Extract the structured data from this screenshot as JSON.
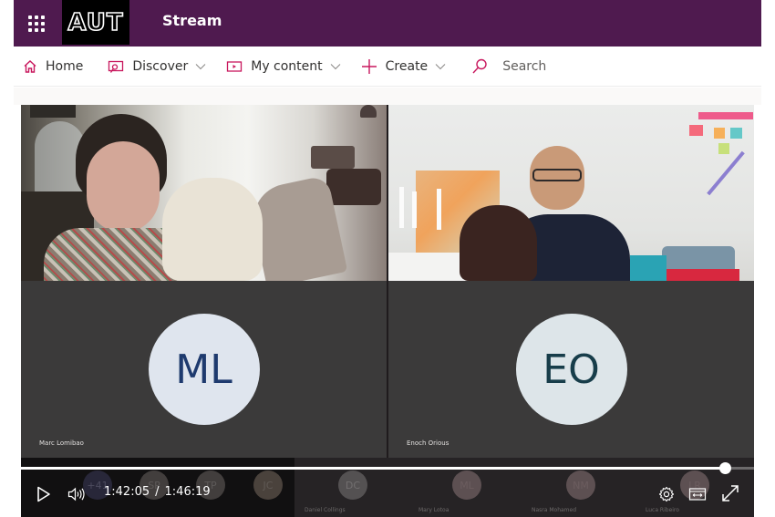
{
  "header": {
    "app_launcher_icon": "waffle-grid-icon",
    "brand_logo_text": "AUT",
    "app_name": "Stream",
    "colors": {
      "suite_bar": "#4f1a4f",
      "accent": "#c8175d"
    }
  },
  "nav": {
    "items": [
      {
        "label": "Home",
        "icon": "home-icon",
        "has_dropdown": false
      },
      {
        "label": "Discover",
        "icon": "discover-icon",
        "has_dropdown": true
      },
      {
        "label": "My content",
        "icon": "my-content-icon",
        "has_dropdown": true
      },
      {
        "label": "Create",
        "icon": "plus-icon",
        "has_dropdown": true
      }
    ],
    "search_placeholder": "Search"
  },
  "video": {
    "tiles": [
      {
        "initials": "ML",
        "name": "Marc Lomibao"
      },
      {
        "initials": "EO",
        "name": "Enoch Orious"
      }
    ],
    "participant_strip": [
      {
        "initials": "+41",
        "name": ""
      },
      {
        "initials": "SP",
        "name": ""
      },
      {
        "initials": "TP",
        "name": ""
      },
      {
        "initials": "JC",
        "name": ""
      },
      {
        "initials": "DC",
        "name": "Daniel Collings"
      },
      {
        "initials": "ML",
        "name": "Mary Lotoa"
      },
      {
        "initials": "NM",
        "name": "Nasra Mohamed"
      },
      {
        "initials": "LR",
        "name": "Luca Ribeiro"
      }
    ],
    "controls": {
      "current_time": "1:42:05",
      "separator": "/",
      "duration": "1:46:19",
      "progress_fraction": 0.96
    }
  }
}
